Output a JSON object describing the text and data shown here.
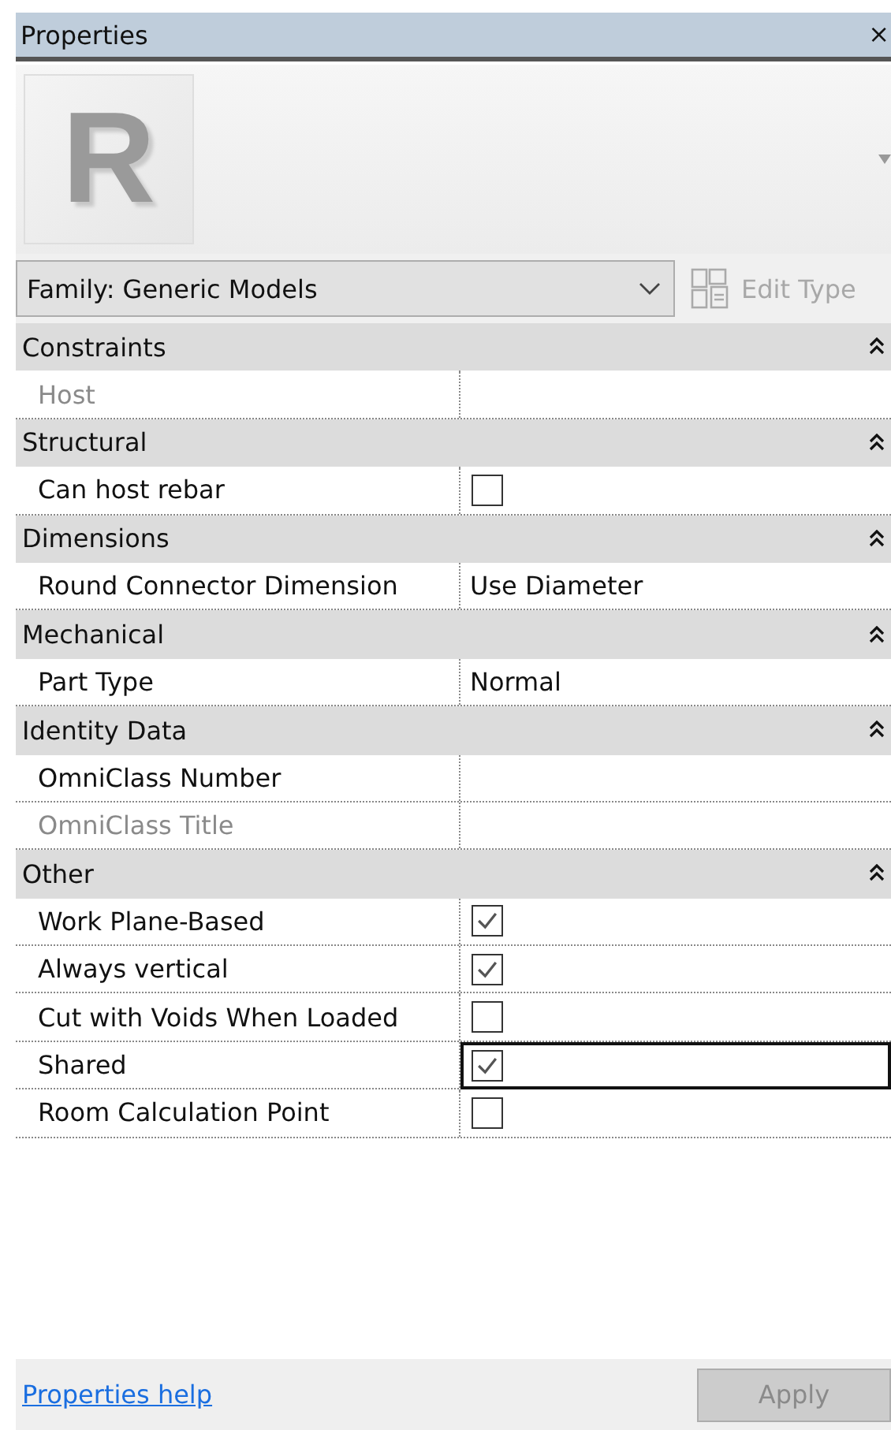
{
  "window": {
    "title": "Properties",
    "close": "×"
  },
  "preview": {
    "logo_text": "R"
  },
  "type_selector": {
    "value": "Family: Generic Models"
  },
  "edit_type": {
    "label": "Edit Type",
    "disabled": true
  },
  "sections": [
    {
      "title": "Constraints",
      "expanded": true,
      "rows": [
        {
          "label": "Host",
          "read_only": true,
          "kind": "text",
          "value": "",
          "selected": false
        }
      ]
    },
    {
      "title": "Structural",
      "expanded": true,
      "rows": [
        {
          "label": "Can host rebar",
          "read_only": false,
          "kind": "checkbox",
          "checked": false,
          "selected": false
        }
      ]
    },
    {
      "title": "Dimensions",
      "expanded": true,
      "rows": [
        {
          "label": "Round Connector Dimension",
          "read_only": false,
          "kind": "text",
          "value": "Use Diameter",
          "selected": false
        }
      ]
    },
    {
      "title": "Mechanical",
      "expanded": true,
      "rows": [
        {
          "label": "Part Type",
          "read_only": false,
          "kind": "text",
          "value": "Normal",
          "selected": false
        }
      ]
    },
    {
      "title": "Identity Data",
      "expanded": true,
      "rows": [
        {
          "label": "OmniClass Number",
          "read_only": false,
          "kind": "text",
          "value": "",
          "selected": false
        },
        {
          "label": "OmniClass Title",
          "read_only": true,
          "kind": "text",
          "value": "",
          "selected": false
        }
      ]
    },
    {
      "title": "Other",
      "expanded": true,
      "rows": [
        {
          "label": "Work Plane-Based",
          "read_only": false,
          "kind": "checkbox",
          "checked": true,
          "selected": false
        },
        {
          "label": "Always vertical",
          "read_only": false,
          "kind": "checkbox",
          "checked": true,
          "selected": false
        },
        {
          "label": "Cut with Voids When Loaded",
          "read_only": false,
          "kind": "checkbox",
          "checked": false,
          "selected": false
        },
        {
          "label": "Shared",
          "read_only": false,
          "kind": "checkbox",
          "checked": true,
          "selected": true
        },
        {
          "label": "Room Calculation Point",
          "read_only": false,
          "kind": "checkbox",
          "checked": false,
          "selected": false
        }
      ]
    }
  ],
  "footer": {
    "help_link": "Properties help",
    "apply": {
      "label": "Apply",
      "disabled": true
    }
  }
}
